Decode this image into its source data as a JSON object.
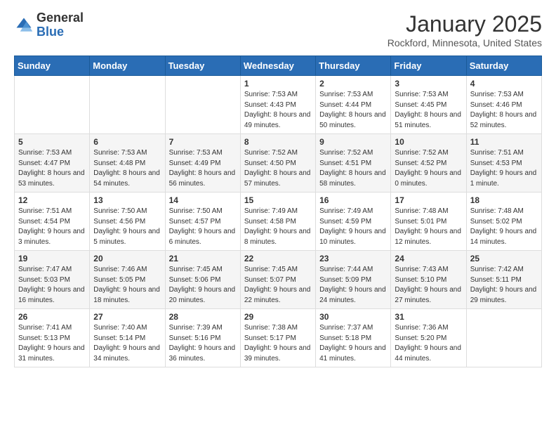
{
  "header": {
    "logo_general": "General",
    "logo_blue": "Blue",
    "month_title": "January 2025",
    "location": "Rockford, Minnesota, United States"
  },
  "weekdays": [
    "Sunday",
    "Monday",
    "Tuesday",
    "Wednesday",
    "Thursday",
    "Friday",
    "Saturday"
  ],
  "weeks": [
    [
      {
        "day": "",
        "sunrise": "",
        "sunset": "",
        "daylight": ""
      },
      {
        "day": "",
        "sunrise": "",
        "sunset": "",
        "daylight": ""
      },
      {
        "day": "",
        "sunrise": "",
        "sunset": "",
        "daylight": ""
      },
      {
        "day": "1",
        "sunrise": "Sunrise: 7:53 AM",
        "sunset": "Sunset: 4:43 PM",
        "daylight": "Daylight: 8 hours and 49 minutes."
      },
      {
        "day": "2",
        "sunrise": "Sunrise: 7:53 AM",
        "sunset": "Sunset: 4:44 PM",
        "daylight": "Daylight: 8 hours and 50 minutes."
      },
      {
        "day": "3",
        "sunrise": "Sunrise: 7:53 AM",
        "sunset": "Sunset: 4:45 PM",
        "daylight": "Daylight: 8 hours and 51 minutes."
      },
      {
        "day": "4",
        "sunrise": "Sunrise: 7:53 AM",
        "sunset": "Sunset: 4:46 PM",
        "daylight": "Daylight: 8 hours and 52 minutes."
      }
    ],
    [
      {
        "day": "5",
        "sunrise": "Sunrise: 7:53 AM",
        "sunset": "Sunset: 4:47 PM",
        "daylight": "Daylight: 8 hours and 53 minutes."
      },
      {
        "day": "6",
        "sunrise": "Sunrise: 7:53 AM",
        "sunset": "Sunset: 4:48 PM",
        "daylight": "Daylight: 8 hours and 54 minutes."
      },
      {
        "day": "7",
        "sunrise": "Sunrise: 7:53 AM",
        "sunset": "Sunset: 4:49 PM",
        "daylight": "Daylight: 8 hours and 56 minutes."
      },
      {
        "day": "8",
        "sunrise": "Sunrise: 7:52 AM",
        "sunset": "Sunset: 4:50 PM",
        "daylight": "Daylight: 8 hours and 57 minutes."
      },
      {
        "day": "9",
        "sunrise": "Sunrise: 7:52 AM",
        "sunset": "Sunset: 4:51 PM",
        "daylight": "Daylight: 8 hours and 58 minutes."
      },
      {
        "day": "10",
        "sunrise": "Sunrise: 7:52 AM",
        "sunset": "Sunset: 4:52 PM",
        "daylight": "Daylight: 9 hours and 0 minutes."
      },
      {
        "day": "11",
        "sunrise": "Sunrise: 7:51 AM",
        "sunset": "Sunset: 4:53 PM",
        "daylight": "Daylight: 9 hours and 1 minute."
      }
    ],
    [
      {
        "day": "12",
        "sunrise": "Sunrise: 7:51 AM",
        "sunset": "Sunset: 4:54 PM",
        "daylight": "Daylight: 9 hours and 3 minutes."
      },
      {
        "day": "13",
        "sunrise": "Sunrise: 7:50 AM",
        "sunset": "Sunset: 4:56 PM",
        "daylight": "Daylight: 9 hours and 5 minutes."
      },
      {
        "day": "14",
        "sunrise": "Sunrise: 7:50 AM",
        "sunset": "Sunset: 4:57 PM",
        "daylight": "Daylight: 9 hours and 6 minutes."
      },
      {
        "day": "15",
        "sunrise": "Sunrise: 7:49 AM",
        "sunset": "Sunset: 4:58 PM",
        "daylight": "Daylight: 9 hours and 8 minutes."
      },
      {
        "day": "16",
        "sunrise": "Sunrise: 7:49 AM",
        "sunset": "Sunset: 4:59 PM",
        "daylight": "Daylight: 9 hours and 10 minutes."
      },
      {
        "day": "17",
        "sunrise": "Sunrise: 7:48 AM",
        "sunset": "Sunset: 5:01 PM",
        "daylight": "Daylight: 9 hours and 12 minutes."
      },
      {
        "day": "18",
        "sunrise": "Sunrise: 7:48 AM",
        "sunset": "Sunset: 5:02 PM",
        "daylight": "Daylight: 9 hours and 14 minutes."
      }
    ],
    [
      {
        "day": "19",
        "sunrise": "Sunrise: 7:47 AM",
        "sunset": "Sunset: 5:03 PM",
        "daylight": "Daylight: 9 hours and 16 minutes."
      },
      {
        "day": "20",
        "sunrise": "Sunrise: 7:46 AM",
        "sunset": "Sunset: 5:05 PM",
        "daylight": "Daylight: 9 hours and 18 minutes."
      },
      {
        "day": "21",
        "sunrise": "Sunrise: 7:45 AM",
        "sunset": "Sunset: 5:06 PM",
        "daylight": "Daylight: 9 hours and 20 minutes."
      },
      {
        "day": "22",
        "sunrise": "Sunrise: 7:45 AM",
        "sunset": "Sunset: 5:07 PM",
        "daylight": "Daylight: 9 hours and 22 minutes."
      },
      {
        "day": "23",
        "sunrise": "Sunrise: 7:44 AM",
        "sunset": "Sunset: 5:09 PM",
        "daylight": "Daylight: 9 hours and 24 minutes."
      },
      {
        "day": "24",
        "sunrise": "Sunrise: 7:43 AM",
        "sunset": "Sunset: 5:10 PM",
        "daylight": "Daylight: 9 hours and 27 minutes."
      },
      {
        "day": "25",
        "sunrise": "Sunrise: 7:42 AM",
        "sunset": "Sunset: 5:11 PM",
        "daylight": "Daylight: 9 hours and 29 minutes."
      }
    ],
    [
      {
        "day": "26",
        "sunrise": "Sunrise: 7:41 AM",
        "sunset": "Sunset: 5:13 PM",
        "daylight": "Daylight: 9 hours and 31 minutes."
      },
      {
        "day": "27",
        "sunrise": "Sunrise: 7:40 AM",
        "sunset": "Sunset: 5:14 PM",
        "daylight": "Daylight: 9 hours and 34 minutes."
      },
      {
        "day": "28",
        "sunrise": "Sunrise: 7:39 AM",
        "sunset": "Sunset: 5:16 PM",
        "daylight": "Daylight: 9 hours and 36 minutes."
      },
      {
        "day": "29",
        "sunrise": "Sunrise: 7:38 AM",
        "sunset": "Sunset: 5:17 PM",
        "daylight": "Daylight: 9 hours and 39 minutes."
      },
      {
        "day": "30",
        "sunrise": "Sunrise: 7:37 AM",
        "sunset": "Sunset: 5:18 PM",
        "daylight": "Daylight: 9 hours and 41 minutes."
      },
      {
        "day": "31",
        "sunrise": "Sunrise: 7:36 AM",
        "sunset": "Sunset: 5:20 PM",
        "daylight": "Daylight: 9 hours and 44 minutes."
      },
      {
        "day": "",
        "sunrise": "",
        "sunset": "",
        "daylight": ""
      }
    ]
  ]
}
